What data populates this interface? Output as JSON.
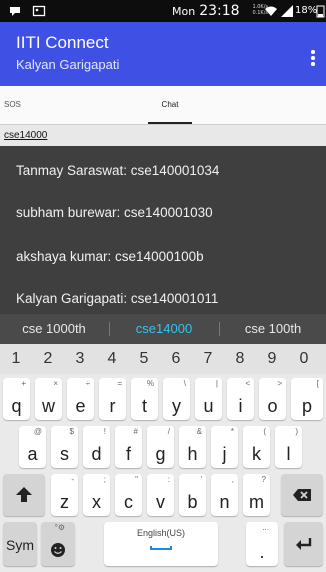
{
  "status_bar": {
    "day": "Mon",
    "time": "23:18",
    "speed": "1.0K/s\n0.1K/s",
    "battery": "18%"
  },
  "app_bar": {
    "title": "IITI Connect",
    "subtitle": "Kalyan Garigapati"
  },
  "tabs": [
    {
      "label": "SOS",
      "selected": false
    },
    {
      "label": "Chat",
      "selected": true
    }
  ],
  "group": {
    "name": "cse14000"
  },
  "messages": [
    "Tanmay Saraswat: cse140001034",
    "subham burewar: cse140001030",
    "akshaya kumar: cse14000100b",
    "Kalyan Garigapati: cse140001011"
  ],
  "keyboard": {
    "suggestions": [
      {
        "text": "cse 1000th",
        "active": false
      },
      {
        "text": "cse14000",
        "active": true
      },
      {
        "text": "cse 100th",
        "active": false
      }
    ],
    "numbers": [
      "1",
      "2",
      "3",
      "4",
      "5",
      "6",
      "7",
      "8",
      "9",
      "0"
    ],
    "row1": [
      {
        "key": "q",
        "alt": "+"
      },
      {
        "key": "w",
        "alt": "×"
      },
      {
        "key": "e",
        "alt": "÷"
      },
      {
        "key": "r",
        "alt": "="
      },
      {
        "key": "t",
        "alt": "%"
      },
      {
        "key": "y",
        "alt": "\\"
      },
      {
        "key": "u",
        "alt": "|"
      },
      {
        "key": "i",
        "alt": "<"
      },
      {
        "key": "o",
        "alt": ">"
      },
      {
        "key": "p",
        "alt": "["
      }
    ],
    "row2": [
      {
        "key": "a",
        "alt": "@"
      },
      {
        "key": "s",
        "alt": "$"
      },
      {
        "key": "d",
        "alt": "!"
      },
      {
        "key": "f",
        "alt": "#"
      },
      {
        "key": "g",
        "alt": "/"
      },
      {
        "key": "h",
        "alt": "&"
      },
      {
        "key": "j",
        "alt": "*"
      },
      {
        "key": "k",
        "alt": "("
      },
      {
        "key": "l",
        "alt": ")"
      }
    ],
    "row3": [
      {
        "key": "z",
        "alt": "-"
      },
      {
        "key": "x",
        "alt": ";"
      },
      {
        "key": "c",
        "alt": "\""
      },
      {
        "key": "v",
        "alt": ":"
      },
      {
        "key": "b",
        "alt": "'"
      },
      {
        "key": "n",
        "alt": ","
      },
      {
        "key": "m",
        "alt": "?"
      }
    ],
    "sym_label": "Sym",
    "language": "English(US)",
    "period": ".",
    "period_alt": "..."
  },
  "colors": {
    "app_bar": "#3f51e5",
    "message_bg": "#3f3f3f",
    "suggestion_active": "#34c3f0"
  }
}
